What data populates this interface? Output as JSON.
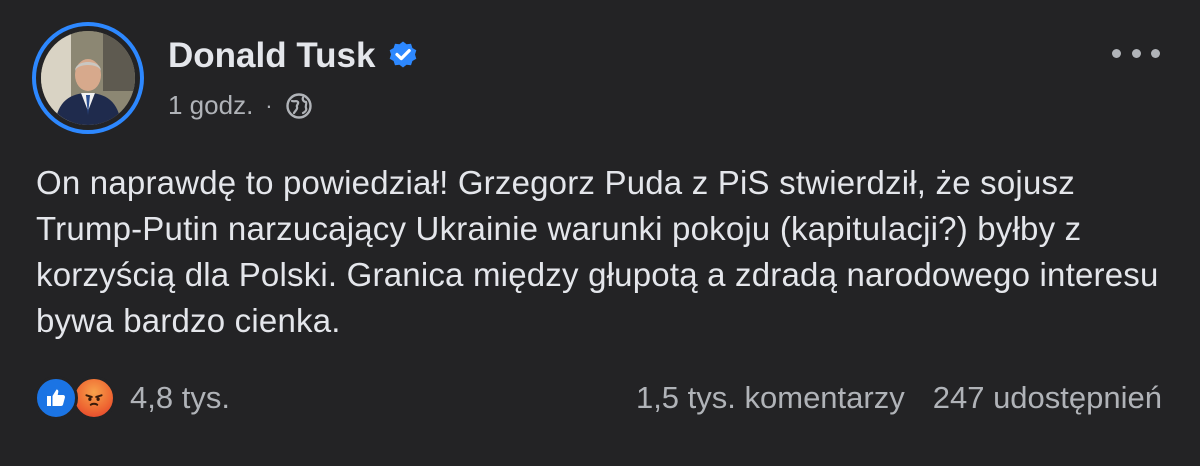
{
  "post": {
    "author": "Donald Tusk",
    "time": "1 godz.",
    "separator": "·",
    "text": "On naprawdę to powiedział! Grzegorz Puda z PiS stwierdził, że sojusz Trump-Putin narzucający Ukrainie warunki pokoju (kapitulacji?) byłby z korzyścią dla Polski. Granica między głupotą a zdradą narodowego interesu bywa bardzo cienka.",
    "reactions_count": "4,8 tys.",
    "comments": "1,5 tys. komentarzy",
    "shares": "247 udostępnień"
  },
  "icons": {
    "verified": "verified-badge-icon",
    "audience": "globe-icon",
    "menu": "more-options-icon",
    "reactions": [
      "like-icon",
      "angry-icon"
    ]
  },
  "colors": {
    "background": "#232325",
    "accent": "#2d88ff",
    "like": "#1b74e4",
    "text": "#e4e6eb",
    "secondary_text": "#b0b3b8"
  }
}
